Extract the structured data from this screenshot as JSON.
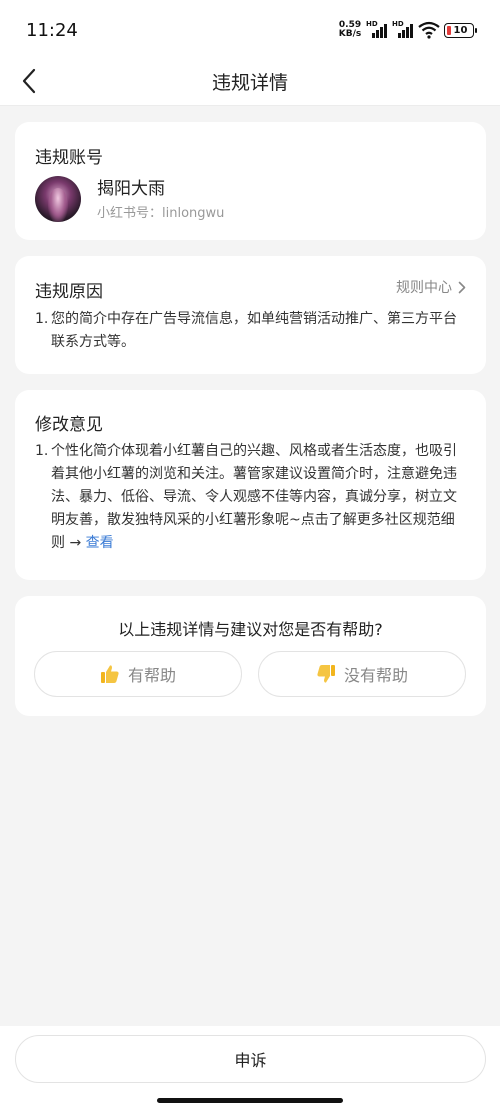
{
  "status_bar": {
    "time": "11:24",
    "network_speed_value": "0.59",
    "network_speed_unit": "KB/s",
    "sim1_label": "HD",
    "sim2_label": "HD",
    "battery_level": "10"
  },
  "navbar": {
    "title": "违规详情",
    "back_icon": "chevron-left-icon"
  },
  "account_card": {
    "title": "违规账号",
    "name": "揭阳大雨",
    "id_text": "小红书号：linlongwu"
  },
  "reason_card": {
    "title": "违规原因",
    "rules_link": "规则中心",
    "items": [
      {
        "index": "1.",
        "text": "您的简介中存在广告导流信息，如单纯营销活动推广、第三方平台联系方式等。"
      }
    ]
  },
  "advice_card": {
    "title": "修改意见",
    "items": [
      {
        "index": "1.",
        "text": "个性化简介体现着小红薯自己的兴趣、风格或者生活态度，也吸引着其他小红薯的浏览和关注。薯管家建议设置简介时，注意避免违法、暴力、低俗、导流、令人观感不佳等内容，真诚分享，树立文明友善，散发独特风采的小红薯形象呢~点击了解更多社区规范细则 → ",
        "link": "查看"
      }
    ]
  },
  "feedback_card": {
    "question": "以上违规详情与建议对您是否有帮助?",
    "helpful_label": "有帮助",
    "not_helpful_label": "没有帮助",
    "helpful_icon": "thumbs-up-icon",
    "not_helpful_icon": "thumbs-down-icon"
  },
  "bottom": {
    "appeal_label": "申诉"
  },
  "colors": {
    "background": "#f4f4f4",
    "card": "#ffffff",
    "link": "#3a7bd5",
    "thumb": "#f5c542"
  }
}
